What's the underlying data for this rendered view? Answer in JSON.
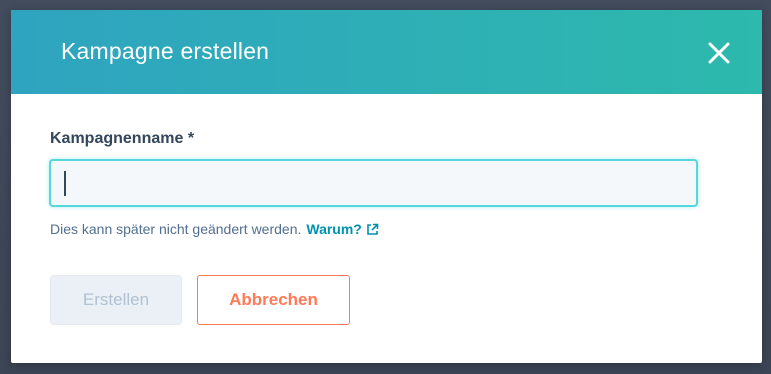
{
  "dialog": {
    "title": "Kampagne erstellen",
    "close_icon": "close-icon"
  },
  "form": {
    "field_label": "Kampagnenname *",
    "input_value": "",
    "input_placeholder": "",
    "help_text": "Dies kann später nicht geändert werden.",
    "help_link": "Warum?",
    "help_link_icon": "external-link-icon"
  },
  "actions": {
    "create_label": "Erstellen",
    "cancel_label": "Abbrechen"
  },
  "colors": {
    "header_gradient_start": "#2fa4c0",
    "header_gradient_end": "#2db9ad",
    "input_focus_border": "#56d6dd",
    "link": "#0091ae",
    "cancel_accent": "#ff7a59",
    "disabled_button_bg": "#eaf0f6"
  }
}
